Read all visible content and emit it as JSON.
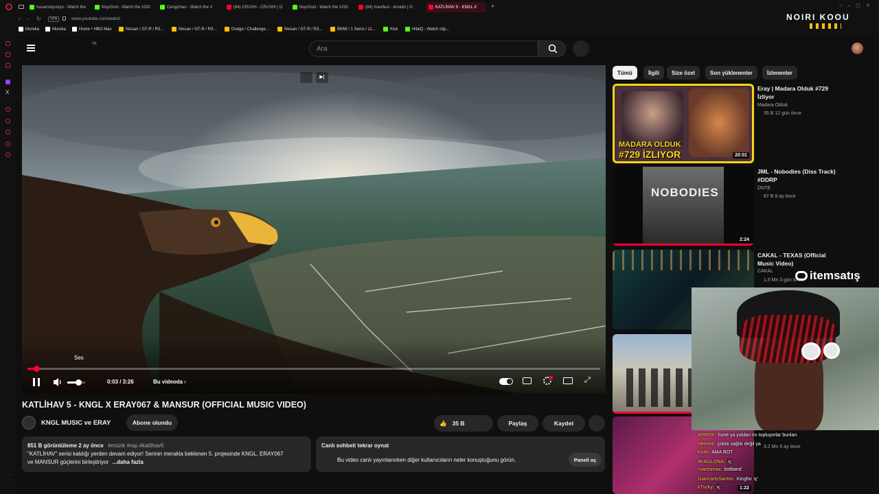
{
  "browser": {
    "tabs": [
      {
        "title": "husarnviyuviyu - Watch the",
        "icon": "kick-icon",
        "color": "#53fc18"
      },
      {
        "title": "NoyrGod - Watch the VOD",
        "icon": "kick-icon",
        "color": "#53fc18"
      },
      {
        "title": "Cengizhan - Watch the V",
        "icon": "kick-icon",
        "color": "#53fc18"
      },
      {
        "title": "(84) CRUSH - CRUSHI | O",
        "icon": "youtube-icon",
        "color": "#ff0033"
      },
      {
        "title": "NoyrGod - Watch the VOD",
        "icon": "kick-icon",
        "color": "#53fc18"
      },
      {
        "title": "(84) manifest - Amatör | O",
        "icon": "youtube-icon",
        "color": "#ff0033"
      },
      {
        "title": "KATLİHAV 5 - KNGL X",
        "icon": "youtube-icon",
        "color": "#ff0033",
        "active": true
      }
    ],
    "url": "www.youtube.com/watch",
    "vpn_label": "VPN",
    "bookmarks": [
      {
        "label": "Mureka",
        "color": "#ffffff"
      },
      {
        "label": "Mureka",
        "color": "#ffffff"
      },
      {
        "label": "Home • HBO Max",
        "color": "#ffffff"
      },
      {
        "label": "Nissan / GT-R / R3...",
        "color": "#f5c400"
      },
      {
        "label": "Nissan / GT-R / R3...",
        "color": "#f5c400"
      },
      {
        "label": "Dodge / Challenge...",
        "color": "#f5c400"
      },
      {
        "label": "Nissan / GT-R / R3...",
        "color": "#f5c400"
      },
      {
        "label": "BMW / 1 Serisi / 11...",
        "color": "#f5c400"
      },
      {
        "label": "Kick",
        "color": "#53fc18"
      },
      {
        "label": "HilalQ - Watch clip...",
        "color": "#53fc18"
      }
    ]
  },
  "header": {
    "country_code": "TR",
    "search_placeholder": "Ara"
  },
  "player": {
    "tooltip": "Ses",
    "time": "0:03 / 3:26",
    "chapter_label": "Bu videoda",
    "progress": 0.015,
    "volume": 0.6
  },
  "video": {
    "title": "KATLİHAV 5 - KNGL X ERAY067 & MANSUR (OFFICIAL MUSIC VIDEO)",
    "channel": "KNGL MUSIC ve ERAY",
    "subscribe_label": "Abone olundu",
    "likes": "35 B",
    "share_label": "Paylaş",
    "save_label": "Kaydet",
    "views_date": "851 B görüntüleme  2 ay önce",
    "tags": "#müzik #rap #katlihav5",
    "desc_line1": "\"KATLİHAV\" serisi kaldığı yerden devam ediyor! Serinin merakla beklenen 5. projesinde KNGL, ERAY067",
    "desc_line2": "ve MANSUR güçlerini birleştiriyor",
    "more_label": "...daha fazla"
  },
  "live_chat": {
    "title": "Canlı sohbeti tekrar oynat",
    "text": "Bu video canlı yayınlanırken diğer kullanıcıların neler konuştuğunu görün.",
    "button": "Paneli aç"
  },
  "chips": [
    "Tümü",
    "İlgili",
    "Size özel",
    "Son yüklenenler",
    "İzlenenler"
  ],
  "related": [
    {
      "title": "Eray | Madara Olduk #729 İzliyor",
      "channel": "Madara Olduk",
      "meta": "35 B   12 gün önce",
      "duration": "20:01",
      "thumb_text": [
        "MADARA OLDUK",
        "#729 İZLIYOR"
      ]
    },
    {
      "title": "JML - Nobodies (Diss Track) #DDRP",
      "channel": "DNTE",
      "meta": "87 B   8 ay önce",
      "duration": "2:24",
      "thumb_text": [
        "NOBODIES"
      ]
    },
    {
      "title": "CAKAL - TEXAS (Official Music Video)",
      "channel": "CAKAL",
      "meta": "1,5 Mn   3 gün önce",
      "duration": "",
      "thumb_text": []
    },
    {
      "title": "",
      "channel": "",
      "meta": "",
      "duration": "",
      "thumb_text": []
    },
    {
      "title": "",
      "channel": "",
      "meta": "3.2 Mn   5 ay önce",
      "duration": "1:22",
      "thumb_text": []
    }
  ],
  "overlay": {
    "brand": "itemsatış",
    "logo_text": "NOIRI KOOU",
    "chat": [
      {
        "user": "IERR00:",
        "msg": "hune ya yoldan mı topluyorlar bunları"
      },
      {
        "user": "Helmek:",
        "msg": "çokta sağlık değil ya"
      },
      {
        "user": "Kickt:",
        "msg": "AMA BOT"
      },
      {
        "user": "#KNGLONA:",
        "msg": "🦅"
      },
      {
        "user": "ruaresmaa:",
        "msg": "botband"
      },
      {
        "user": "GiancarloSantos:",
        "msg": "Kingho 🦅"
      },
      {
        "user": "kTucky:",
        "msg": "🦅"
      }
    ]
  },
  "colors": {
    "accent": "#ff0033",
    "chip_selected": "#f1f1f1",
    "madara_yellow": "#f7d617"
  }
}
